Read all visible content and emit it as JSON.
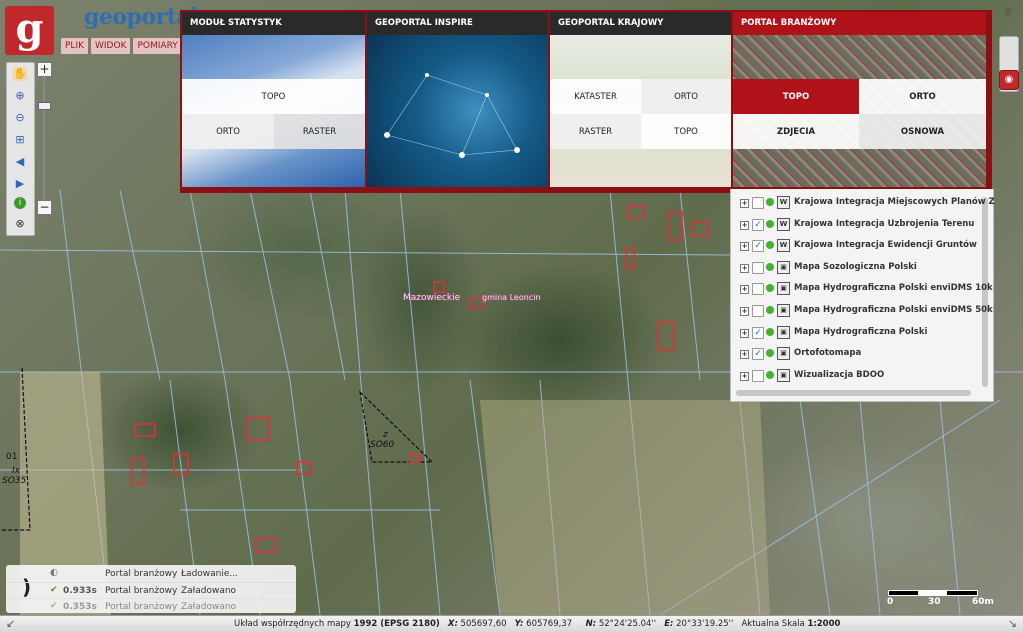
{
  "app": {
    "logo_letter": "g",
    "brand_prefix": "geoportal",
    "brand_suffix": ".",
    "menu": [
      "PLIK",
      "WIDOK",
      "POMIARY"
    ]
  },
  "map_labels": {
    "region": "Mazowieckie",
    "commune": "gmina Leoncin",
    "parcel_a_top": "z",
    "parcel_a_bottom": "SO60",
    "parcel_b_number": "01",
    "parcel_b_top": "Ix",
    "parcel_b_bottom": "SO35"
  },
  "portals": [
    {
      "title": "MODUŁ STATYSTYK",
      "buttons": [
        "TOPO",
        "ORTO",
        "RASTER"
      ]
    },
    {
      "title": "GEOPORTAL INSPIRE",
      "buttons": []
    },
    {
      "title": "GEOPORTAL KRAJOWY",
      "buttons": [
        "KATASTER",
        "ORTO",
        "RASTER",
        "TOPO"
      ]
    },
    {
      "title": "PORTAL BRANŻOWY",
      "buttons": [
        "TOPO",
        "ORTO",
        "ZDJECIA",
        "OSNOWA"
      ]
    }
  ],
  "layers": [
    {
      "name": "Krajowa Integracja Miejscowych Planów Z",
      "checked": false,
      "icon": "wms-icon"
    },
    {
      "name": "Krajowa Integracja Uzbrojenia Terenu",
      "checked": true,
      "icon": "wms-icon"
    },
    {
      "name": "Krajowa Integracja Ewidencji Gruntów",
      "checked": true,
      "icon": "wms-icon"
    },
    {
      "name": "Mapa Sozologiczna Polski",
      "checked": false,
      "icon": "map-icon"
    },
    {
      "name": "Mapa Hydrograficzna Polski enviDMS 10k",
      "checked": false,
      "icon": "map-icon"
    },
    {
      "name": "Mapa Hydrograficzna Polski enviDMS 50k",
      "checked": false,
      "icon": "map-icon"
    },
    {
      "name": "Mapa Hydrograficzna Polski",
      "checked": true,
      "icon": "map-icon"
    },
    {
      "name": "Ortofotomapa",
      "checked": true,
      "icon": "map-icon"
    },
    {
      "name": "Wizualizacja BDOO",
      "checked": false,
      "icon": "map-icon"
    }
  ],
  "status_log": [
    {
      "time": "",
      "portal": "Portal branżowy",
      "state": "Ładowanie..."
    },
    {
      "time": "0.933s",
      "portal": "Portal branżowy",
      "state": "Załadowano"
    },
    {
      "time": "0.353s",
      "portal": "Portal branżowy",
      "state": "Załadowano"
    }
  ],
  "scalebar": {
    "t0": "0",
    "t1": "30",
    "t2": "60m"
  },
  "bottom": {
    "crs_label": "Układ współrzędnych mapy",
    "crs_value": "1992 (EPSG 2180)",
    "x_label": "X:",
    "x_value": "505697,60",
    "y_label": "Y:",
    "y_value": "605769,37",
    "n_label": "N:",
    "n_value": "52°24'25.04''",
    "e_label": "E:",
    "e_value": "20°33'19.25''",
    "scale_label": "Aktualna Skala",
    "scale_value": "1:2000"
  },
  "colors": {
    "brand_red": "#c0282b",
    "panel_border": "#8b1013",
    "link_blue": "#2e6db2",
    "ok_green": "#3c9a2f"
  }
}
